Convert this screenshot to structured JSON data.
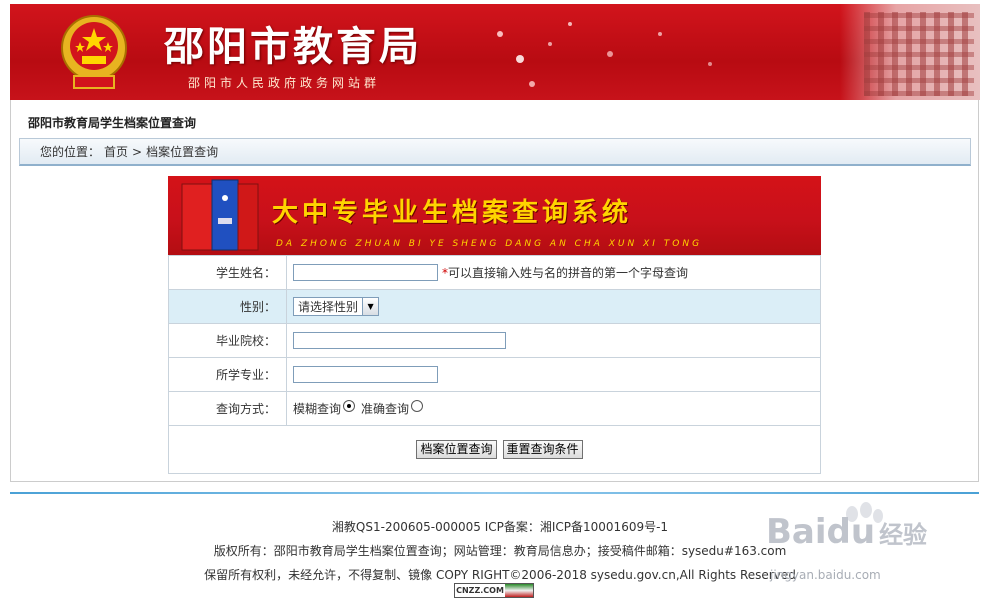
{
  "header": {
    "title": "邵阳市教育局",
    "subtitle": "邵阳市人民政府政务网站群"
  },
  "page": {
    "heading": "邵阳市教育局学生档案位置查询",
    "breadcrumb": {
      "prefix": "您的位置：",
      "home": "首页",
      "separator": ">",
      "current": "档案位置查询"
    }
  },
  "banner": {
    "title": "大中专毕业生档案查询系统",
    "pinyin": "DA ZHONG ZHUAN BI YE SHENG DANG AN CHA XUN XI TONG"
  },
  "form": {
    "name_label": "学生姓名：",
    "name_value": "",
    "name_hint_star": "*",
    "name_hint": "可以直接输入姓与名的拼音的第一个字母查询",
    "gender_label": "性别：",
    "gender_selected": "请选择性别",
    "school_label": "毕业院校：",
    "school_value": "",
    "major_label": "所学专业：",
    "major_value": "",
    "mode_label": "查询方式：",
    "mode_fuzzy": "模糊查询",
    "mode_exact": "准确查询",
    "mode_selected": "模糊查询",
    "search_button": "档案位置查询",
    "reset_button": "重置查询条件"
  },
  "footer": {
    "line1": "湘教QS1-200605-000005 ICP备案：湘ICP备10001609号-1",
    "line2": "版权所有：邵阳市教育局学生档案位置查询；网站管理：教育局信息办；接受稿件邮箱：sysedu#163.com",
    "line3": "保留所有权利，未经允许，不得复制、镜像 COPY RIGHT©2006-2018 sysedu.gov.cn,All Rights Reserved",
    "stat_badge": "CNZZ.COM"
  },
  "watermark": {
    "brand": "Bai",
    "brand2": "du",
    "brand_cn": "经验",
    "url": "jingyan.baidu.com"
  },
  "colors": {
    "header_red": "#c8101a",
    "banner_yellow": "#ffd400",
    "alt_row": "#dbeef7",
    "footer_line": "#4aa1d6"
  }
}
